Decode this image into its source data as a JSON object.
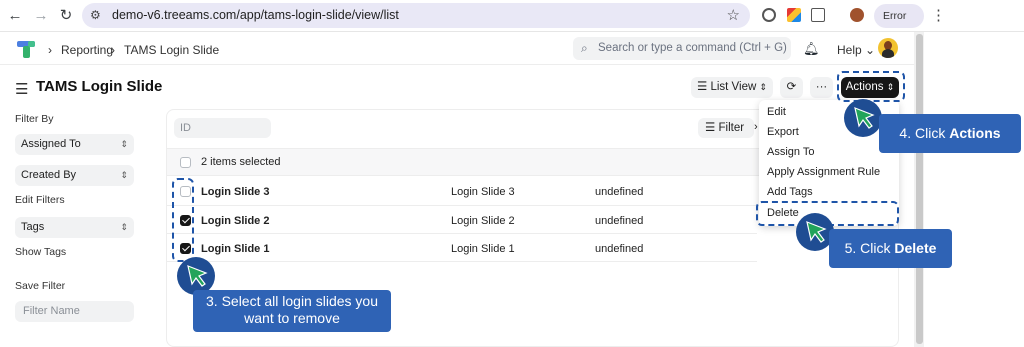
{
  "browser": {
    "url": "demo-v6.treeams.com/app/tams-login-slide/view/list",
    "profile_status": "Error"
  },
  "navbar": {
    "breadcrumbs": [
      "Reporting",
      "TAMS Login Slide"
    ],
    "search_placeholder": "Search or type a command (Ctrl + G)",
    "help_label": "Help"
  },
  "page": {
    "title": "TAMS Login Slide",
    "list_view_label": "List View",
    "more_label": "···",
    "actions_label": "Actions"
  },
  "sidebar": {
    "filter_by_label": "Filter By",
    "assigned_to": "Assigned To",
    "created_by": "Created By",
    "edit_filters": "Edit Filters",
    "tags": "Tags",
    "show_tags": "Show Tags",
    "save_filter": "Save Filter",
    "filter_name_placeholder": "Filter Name"
  },
  "list": {
    "id_placeholder": "ID",
    "filter_label": "Filter",
    "selection_text": "2 items selected",
    "rows": [
      {
        "title": "Login Slide 3",
        "name": "Login Slide 3",
        "value": "undefined",
        "checked": false
      },
      {
        "title": "Login Slide 2",
        "name": "Login Slide 2",
        "value": "undefined",
        "checked": true
      },
      {
        "title": "Login Slide 1",
        "name": "Login Slide 1",
        "value": "undefined",
        "checked": true
      }
    ]
  },
  "actions_menu": {
    "items": [
      "Edit",
      "Export",
      "Assign To",
      "Apply Assignment Rule",
      "Add Tags",
      "Delete"
    ]
  },
  "annotations": {
    "step3_text": "3. Select all login slides you want to remove",
    "step4_prefix": "4. Click ",
    "step4_bold": "Actions",
    "step5_prefix": "5. Click ",
    "step5_bold": "Delete"
  },
  "colors": {
    "annotation_blue": "#2f63b5",
    "pointer_green": "#22a45a",
    "actions_button": "#171717"
  }
}
